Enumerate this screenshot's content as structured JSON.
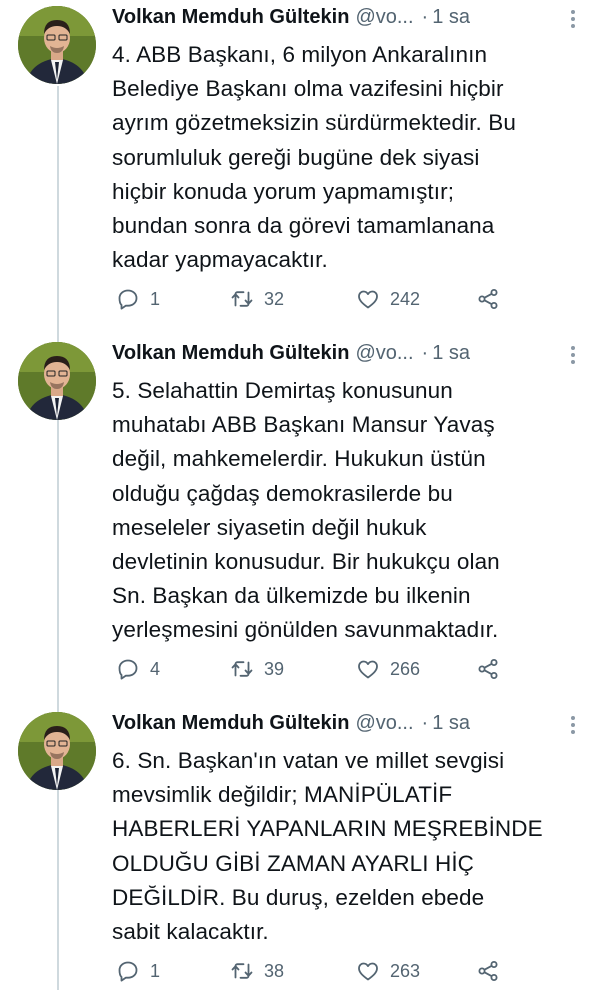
{
  "tweets": [
    {
      "name": "Volkan Memduh Gültekin",
      "handle": "@vo...",
      "time": "1 sa",
      "lines": [
        "4. ABB Başkanı, 6 milyon Ankaralının",
        "Belediye Başkanı olma vazifesini hiçbir",
        "ayrım gözetmeksizin sürdürmektedir. Bu",
        "sorumluluk gereği bugüne dek siyasi",
        "hiçbir konuda yorum yapmamıştır;",
        "bundan sonra da görevi tamamlanana",
        "kadar yapmayacaktır."
      ],
      "replies": "1",
      "retweets": "32",
      "likes": "242"
    },
    {
      "name": "Volkan Memduh Gültekin",
      "handle": "@vo...",
      "time": "1 sa",
      "lines": [
        "5. Selahattin Demirtaş konusunun",
        "muhatabı ABB Başkanı Mansur Yavaş",
        "değil, mahkemelerdir. Hukukun üstün",
        "olduğu çağdaş demokrasilerde bu",
        "meseleler siyasetin değil hukuk",
        "devletinin konusudur. Bir hukukçu olan",
        "Sn. Başkan da ülkemizde bu ilkenin",
        "yerleşmesini gönülden savunmaktadır."
      ],
      "replies": "4",
      "retweets": "39",
      "likes": "266"
    },
    {
      "name": "Volkan Memduh Gültekin",
      "handle": "@vo...",
      "time": "1 sa",
      "lines": [
        "6. Sn. Başkan'ın vatan ve millet sevgisi",
        "mevsimlik değildir; MANİPÜLATİF",
        "HABERLERİ YAPANLARIN MEŞREBİNDE",
        "OLDUĞU GİBİ ZAMAN AYARLI HİÇ",
        "DEĞİLDİR. Bu duruş, ezelden ebede",
        "sabit kalacaktır."
      ],
      "replies": "1",
      "retweets": "38",
      "likes": "263"
    }
  ],
  "icons": {
    "reply": "reply-icon",
    "retweet": "retweet-icon",
    "like": "heart-icon",
    "share": "share-icon",
    "more": "more-icon"
  },
  "colors": {
    "text": "#0f1419",
    "secondary": "#536471",
    "thread_line": "#cfd9de"
  }
}
